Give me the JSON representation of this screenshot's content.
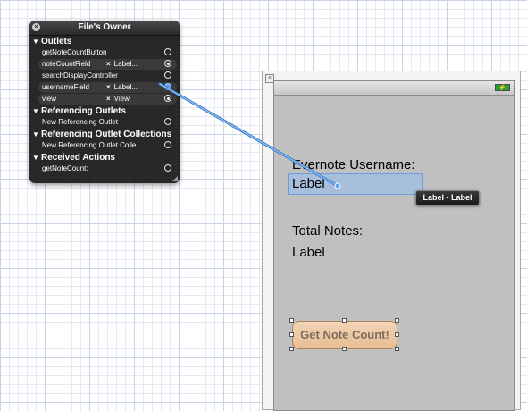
{
  "hud": {
    "title": "File's Owner",
    "sections": {
      "outlets": "Outlets",
      "referencing_outlets": "Referencing Outlets",
      "referencing_outlet_collections": "Referencing Outlet Collections",
      "received_actions": "Received Actions"
    },
    "outlets": [
      {
        "name": "getNoteCountButton",
        "target": ""
      },
      {
        "name": "noteCountField",
        "target": "Label..."
      },
      {
        "name": "searchDisplayController",
        "target": ""
      },
      {
        "name": "usernameField",
        "target": "Label..."
      },
      {
        "name": "view",
        "target": "View"
      }
    ],
    "referencing_outlet": "New Referencing Outlet",
    "referencing_outlet_collection": "New Referencing Outlet Colle...",
    "received_action": "getNoteCount:"
  },
  "canvas": {
    "username_label": "Evernote Username:",
    "username_field": "Label",
    "total_notes_label": "Total Notes:",
    "note_count_label": "Label",
    "button_label": "Get Note Count!",
    "tooltip": "Label - Label",
    "battery_glyph": "⚡"
  },
  "colors": {
    "hud_background": "#181818",
    "connection_line": "#5fa3ec",
    "button_fill": "#e8bd92",
    "device_background": "#c0c0c0"
  },
  "icons": [
    "close-icon",
    "disclosure-triangle-icon",
    "outlet-ring-icon",
    "resize-grip-icon",
    "battery-icon"
  ]
}
